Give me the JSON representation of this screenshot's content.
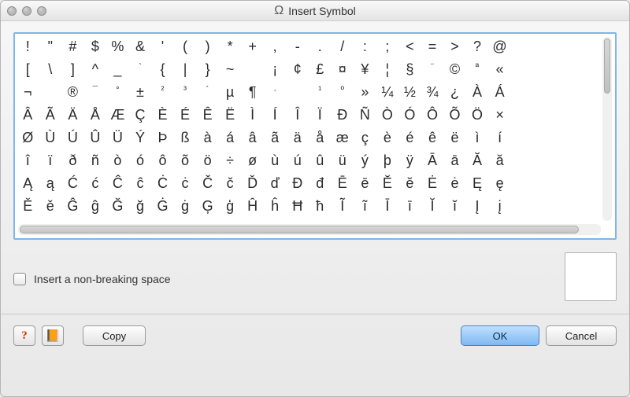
{
  "window": {
    "title": "Insert Symbol",
    "icon": "omega-icon"
  },
  "symbols": {
    "rows": [
      [
        "!",
        "\"",
        "#",
        "$",
        "%",
        "&",
        "'",
        "(",
        ")",
        "*",
        "+",
        ",",
        "-",
        ".",
        "/",
        ":",
        ";",
        "<",
        "=",
        ">",
        "?",
        "@"
      ],
      [
        "[",
        "\\",
        "]",
        "^",
        "_",
        "`",
        "{",
        "|",
        "}",
        "~",
        "",
        "¡",
        "¢",
        "£",
        "¤",
        "¥",
        "¦",
        "§",
        "¨",
        "©",
        "ª",
        "«"
      ],
      [
        "¬",
        "­",
        "®",
        "¯",
        "°",
        "±",
        "²",
        "³",
        "´",
        "µ",
        "¶",
        "·",
        "",
        "¹",
        "º",
        "»",
        "¼",
        "½",
        "¾",
        "¿",
        "À",
        "Á"
      ],
      [
        "Â",
        "Ã",
        "Ä",
        "Å",
        "Æ",
        "Ç",
        "È",
        "É",
        "Ê",
        "Ë",
        "Ì",
        "Í",
        "Î",
        "Ï",
        "Ð",
        "Ñ",
        "Ò",
        "Ó",
        "Ô",
        "Õ",
        "Ö",
        "×"
      ],
      [
        "Ø",
        "Ù",
        "Ú",
        "Û",
        "Ü",
        "Ý",
        "Þ",
        "ß",
        "à",
        "á",
        "â",
        "ã",
        "ä",
        "å",
        "æ",
        "ç",
        "è",
        "é",
        "ê",
        "ë",
        "ì",
        "í"
      ],
      [
        "î",
        "ï",
        "ð",
        "ñ",
        "ò",
        "ó",
        "ô",
        "õ",
        "ö",
        "÷",
        "ø",
        "ù",
        "ú",
        "û",
        "ü",
        "ý",
        "þ",
        "ÿ",
        "Ā",
        "ā",
        "Ă",
        "ă"
      ],
      [
        "Ą",
        "ą",
        "Ć",
        "ć",
        "Ĉ",
        "ĉ",
        "Ċ",
        "ċ",
        "Č",
        "č",
        "Ď",
        "ď",
        "Đ",
        "đ",
        "Ē",
        "ē",
        "Ĕ",
        "ĕ",
        "Ė",
        "ė",
        "Ę",
        "ę"
      ],
      [
        "Ě",
        "ě",
        "Ĝ",
        "ĝ",
        "Ğ",
        "ğ",
        "Ġ",
        "ġ",
        "Ģ",
        "ģ",
        "Ĥ",
        "ĥ",
        "Ħ",
        "ħ",
        "Ĩ",
        "ĩ",
        "Ī",
        "ī",
        "Ĭ",
        "ĭ",
        "Į",
        "į"
      ]
    ]
  },
  "checkbox": {
    "label": "Insert a non-breaking space",
    "checked": false
  },
  "buttons": {
    "help": "?",
    "notes": "📙",
    "copy": "Copy",
    "ok": "OK",
    "cancel": "Cancel"
  }
}
